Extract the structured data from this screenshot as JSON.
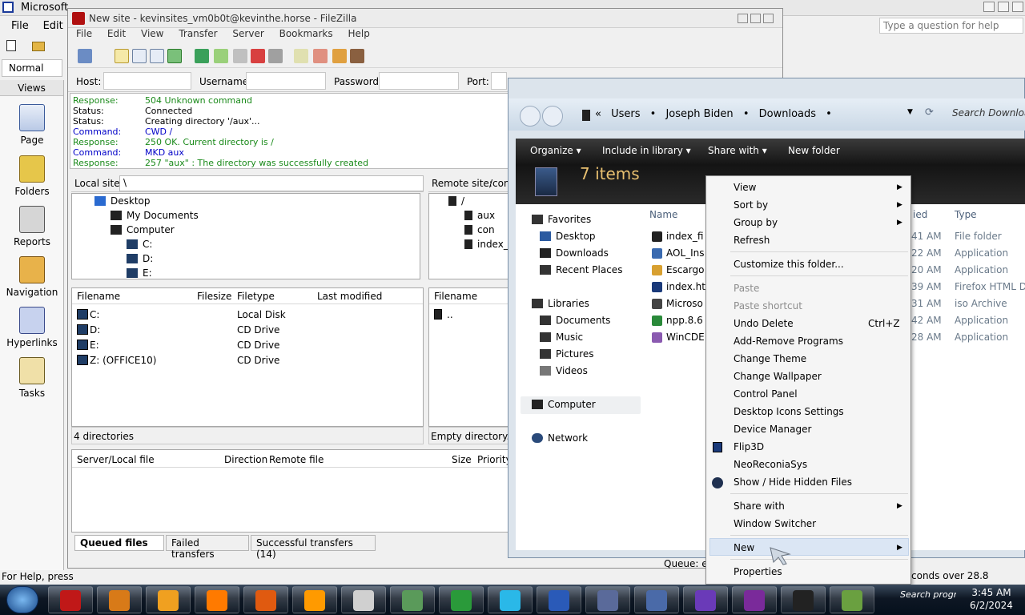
{
  "office": {
    "title": "Microsoft",
    "menu": [
      "File",
      "Edit"
    ],
    "style_value": "Normal",
    "views_header": "Views",
    "views": [
      "Page",
      "Folders",
      "Reports",
      "Navigation",
      "Hyperlinks",
      "Tasks"
    ],
    "help_placeholder": "Type a question for help",
    "status": "For Help, press"
  },
  "filezilla": {
    "title": "New site - kevinsites_vm0b0t@kevinthe.horse - FileZilla",
    "menu": [
      "File",
      "Edit",
      "View",
      "Transfer",
      "Server",
      "Bookmarks",
      "Help"
    ],
    "quickconnect": {
      "host": "Host:",
      "username": "Username:",
      "password": "Password:",
      "port": "Port:"
    },
    "log": [
      {
        "k": "Response:",
        "v": "504 Unknown command",
        "c": "green"
      },
      {
        "k": "Status:",
        "v": "Connected",
        "c": "black"
      },
      {
        "k": "Status:",
        "v": "Creating directory '/aux'...",
        "c": "black"
      },
      {
        "k": "Command:",
        "v": "CWD /",
        "c": "blue"
      },
      {
        "k": "Response:",
        "v": "250 OK. Current directory is /",
        "c": "green"
      },
      {
        "k": "Command:",
        "v": "MKD aux",
        "c": "blue"
      },
      {
        "k": "Response:",
        "v": "257 \"aux\" : The directory was successfully created",
        "c": "green"
      }
    ],
    "local": {
      "label": "Local site:",
      "path": "\\",
      "tree": [
        "Desktop",
        "My Documents",
        "Computer",
        "C:",
        "D:",
        "E:"
      ],
      "columns": [
        "Filename",
        "Filesize",
        "Filetype",
        "Last modified"
      ],
      "files": [
        {
          "name": "C:",
          "type": "Local Disk"
        },
        {
          "name": "D:",
          "type": "CD Drive"
        },
        {
          "name": "E:",
          "type": "CD Drive"
        },
        {
          "name": "Z: (OFFICE10)",
          "type": "CD Drive"
        }
      ],
      "status": "4 directories"
    },
    "remote": {
      "label": "Remote site:",
      "path": "/con",
      "tree": [
        "/",
        "aux",
        "con",
        "index_f"
      ],
      "columns": [
        "Filename"
      ],
      "files": [
        ".."
      ],
      "status": "Empty directory."
    },
    "queue": {
      "columns": [
        "Server/Local file",
        "Direction",
        "Remote file",
        "Size",
        "Priority"
      ],
      "tabs": [
        "Queued files",
        "Failed transfers",
        "Successful transfers (14)"
      ],
      "status": "Queue: er",
      "status_right": "conds over 28.8"
    }
  },
  "explorer": {
    "breadcrumb": [
      "Users",
      "Joseph Biden",
      "Downloads"
    ],
    "search_placeholder": "Search Downloads",
    "commands": [
      "Organize",
      "Include in library",
      "Share with",
      "New folder"
    ],
    "item_count": "7 items",
    "nav": {
      "favorites": "Favorites",
      "favorite_items": [
        "Desktop",
        "Downloads",
        "Recent Places"
      ],
      "libraries": "Libraries",
      "library_items": [
        "Documents",
        "Music",
        "Pictures",
        "Videos"
      ],
      "computer": "Computer",
      "network": "Network"
    },
    "columns": {
      "name": "Name",
      "modified": "ied",
      "type": "Type"
    },
    "files": [
      {
        "name": "index_fi",
        "time": "41 AM",
        "type": "File folder"
      },
      {
        "name": "AOL_Ins",
        "time": "22 AM",
        "type": "Application"
      },
      {
        "name": "Escargo",
        "time": "20 AM",
        "type": "Application"
      },
      {
        "name": "index.ht",
        "time": "39 AM",
        "type": "Firefox HTML D"
      },
      {
        "name": "Microso",
        "time": "31 AM",
        "type": "iso Archive"
      },
      {
        "name": "npp.8.6",
        "time": "42 AM",
        "type": "Application"
      },
      {
        "name": "WinCDE",
        "time": "28 AM",
        "type": "Application"
      }
    ]
  },
  "context_menu": {
    "view": "View",
    "sort_by": "Sort by",
    "group_by": "Group by",
    "refresh": "Refresh",
    "customize": "Customize this folder...",
    "paste": "Paste",
    "paste_shortcut": "Paste shortcut",
    "undo_delete": "Undo Delete",
    "undo_shortcut": "Ctrl+Z",
    "add_remove": "Add-Remove Programs",
    "change_theme": "Change Theme",
    "change_wallpaper": "Change Wallpaper",
    "control_panel": "Control Panel",
    "desktop_icons": "Desktop Icons Settings",
    "device_manager": "Device Manager",
    "flip3d": "Flip3D",
    "neoreconia": "NeoReconiaSys",
    "show_hide": "Show / Hide Hidden Files",
    "share_with": "Share with",
    "window_switcher": "Window Switcher",
    "new": "New",
    "properties": "Properties"
  },
  "taskbar": {
    "search_text": "Search progra",
    "time": "3:45 AM",
    "date": "6/2/2024",
    "apps": [
      "start-orb-icon",
      "filezilla-icon",
      "paint-icon",
      "dreamweaver-icon",
      "vlc-icon",
      "firefox-icon",
      "aim-icon",
      "clock-icon",
      "plant-icon",
      "chrome-icon",
      "gem-icon",
      "world-icon",
      "doc-icon",
      "settings-icon",
      "visual-studio-icon",
      "yahoo-icon",
      "window-icon",
      "chart-icon"
    ]
  },
  "colors": {
    "log_green": "#1a8a1a",
    "log_blue": "#0000c8",
    "explorer_header": "#141414",
    "item_count": "#e8c070"
  }
}
